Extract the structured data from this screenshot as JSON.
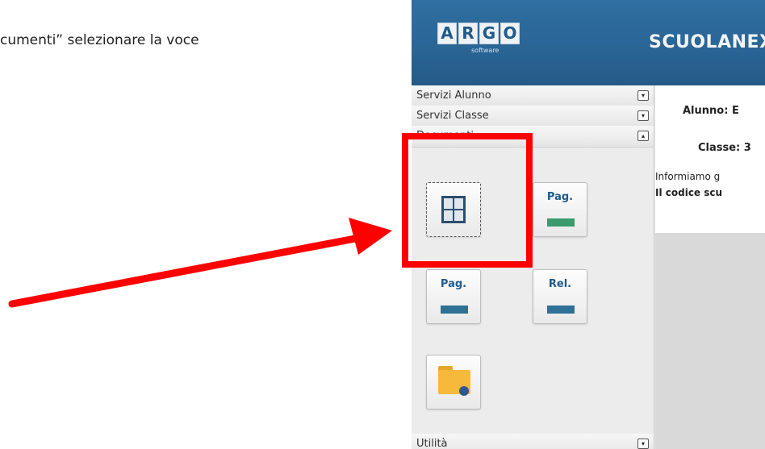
{
  "instruction_text": "cumenti” selezionare la voce",
  "app": {
    "logo": {
      "letters": [
        "A",
        "R",
        "G",
        "O"
      ],
      "sub": "software"
    },
    "brand": "SCUOLANEX"
  },
  "sidebar": {
    "sections": [
      {
        "label": "Servizi Alunno",
        "toggle": "▾"
      },
      {
        "label": "Servizi Classe",
        "toggle": "▾"
      },
      {
        "label": "Documenti",
        "toggle": "▴"
      },
      {
        "label": "Utilità",
        "toggle": "▾"
      }
    ],
    "tiles": [
      {
        "label": "Pag.",
        "bar_color": "#3a9b6b"
      },
      {
        "label": "Pag.",
        "bar_color": "#2e7096"
      },
      {
        "label": "Rel.",
        "bar_color": "#2e7096"
      }
    ]
  },
  "content": {
    "alunno": "Alunno: E",
    "classe": "Classe: 3",
    "info_line": "Informiamo g",
    "codice_line": "Il codice scu"
  },
  "colors": {
    "highlight": "#ff0000",
    "arrow": "#ff0000",
    "header": "#2a6596"
  }
}
